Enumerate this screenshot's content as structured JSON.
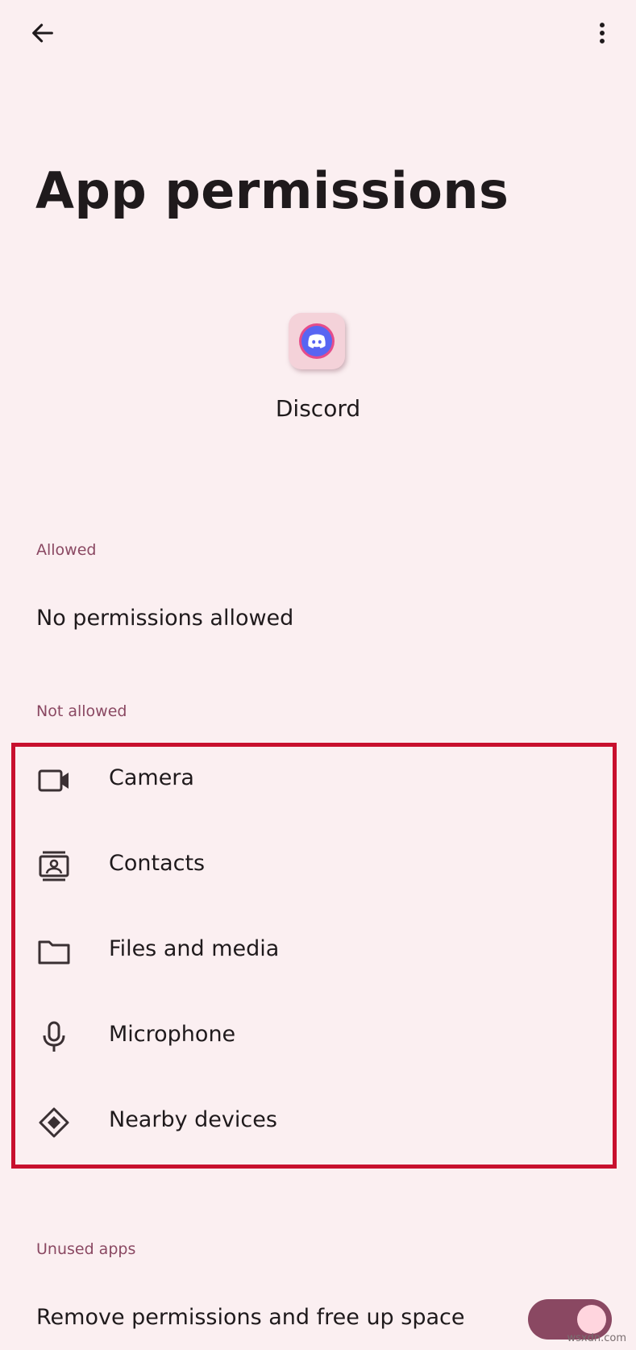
{
  "page": {
    "title": "App permissions"
  },
  "app": {
    "name": "Discord",
    "icon": "discord-icon"
  },
  "sections": {
    "allowed": {
      "header": "Allowed",
      "empty_text": "No permissions allowed"
    },
    "not_allowed": {
      "header": "Not allowed",
      "items": [
        {
          "label": "Camera",
          "icon": "camera-icon"
        },
        {
          "label": "Contacts",
          "icon": "contacts-icon"
        },
        {
          "label": "Files and media",
          "icon": "folder-icon"
        },
        {
          "label": "Microphone",
          "icon": "microphone-icon"
        },
        {
          "label": "Nearby devices",
          "icon": "nearby-devices-icon"
        }
      ]
    },
    "unused_apps": {
      "header": "Unused apps",
      "setting_label": "Remove permissions and free up space",
      "toggle_on": true
    }
  },
  "watermark": "wsxdn.com",
  "colors": {
    "background": "#fbeff1",
    "accent": "#8a4862",
    "highlight": "#c8102e",
    "text": "#1f1a1c"
  }
}
